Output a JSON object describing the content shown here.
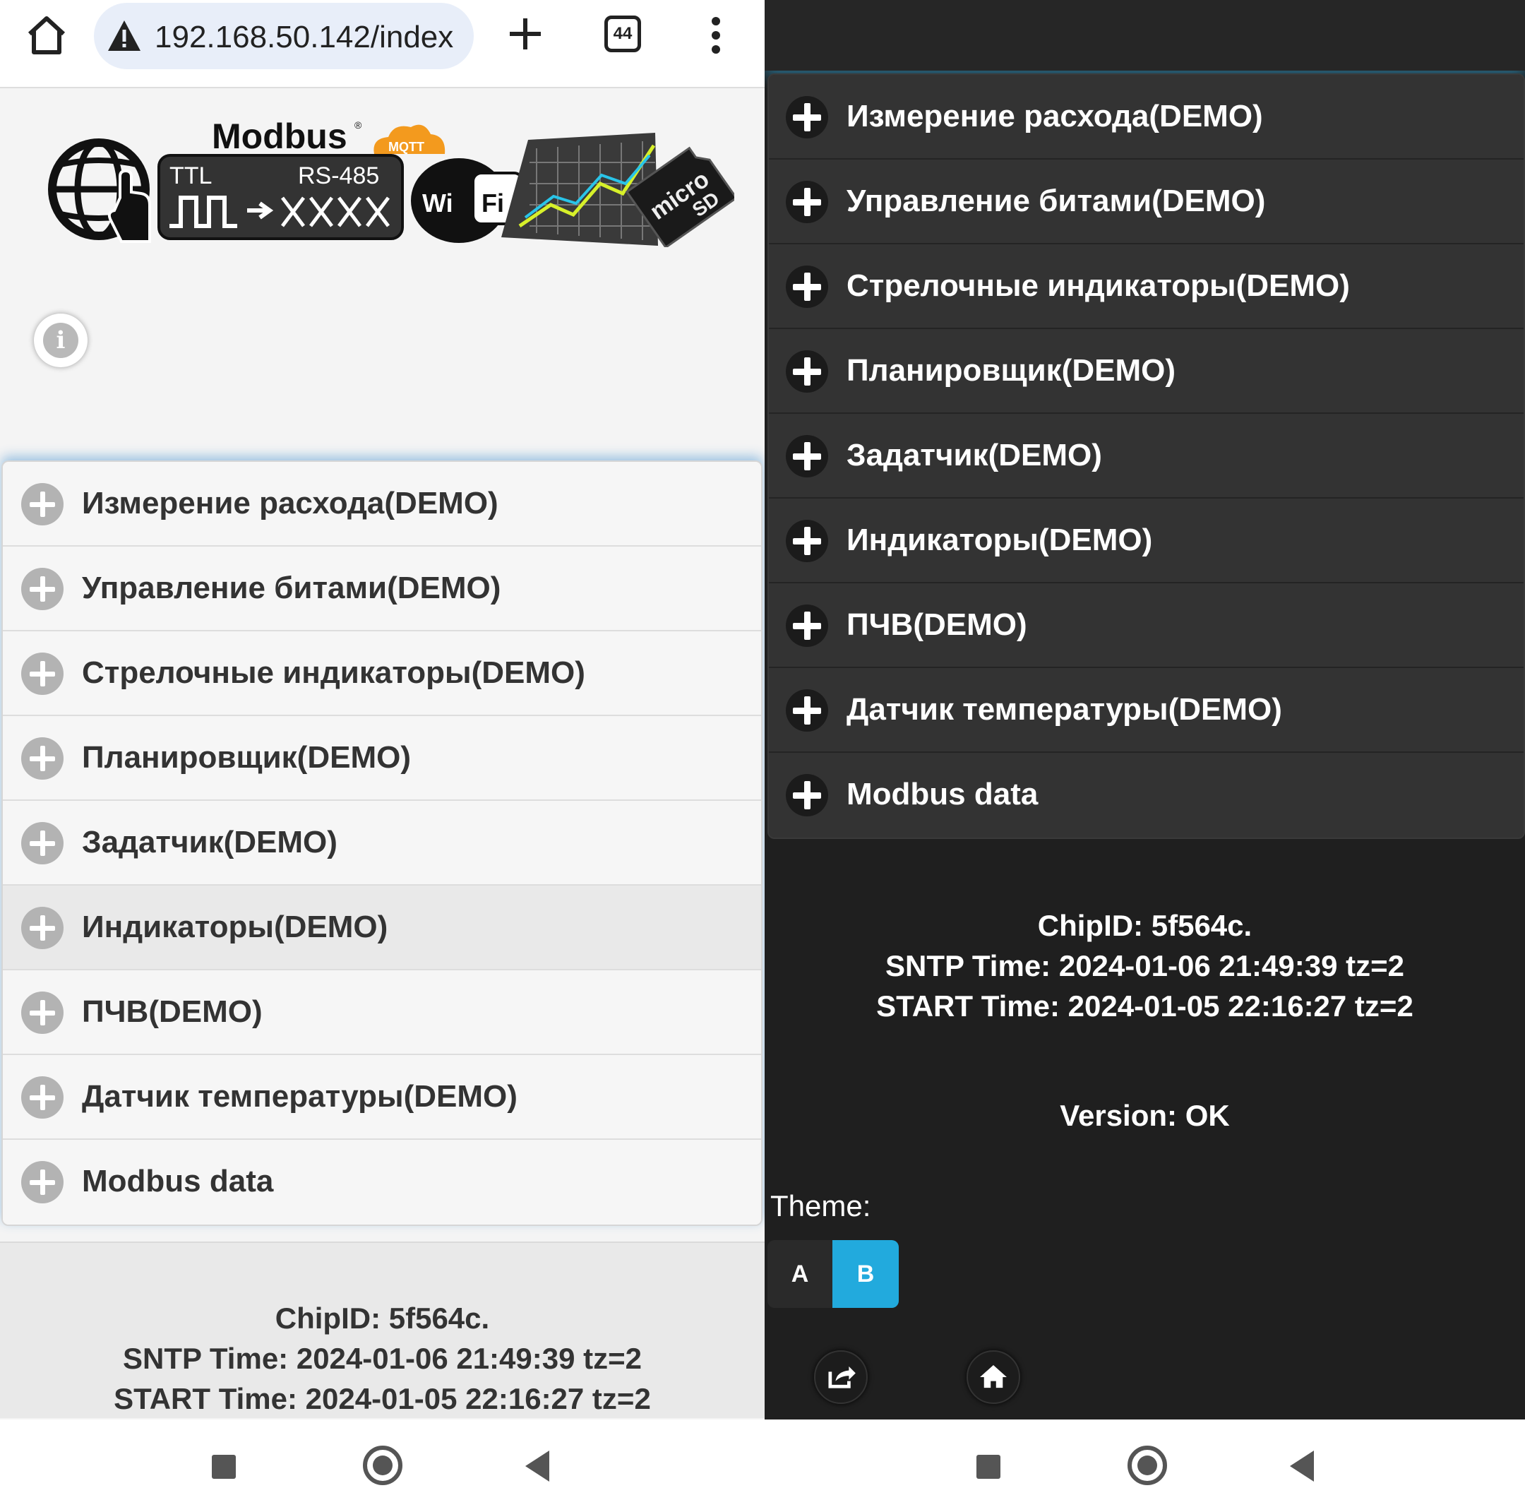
{
  "browser": {
    "url": "192.168.50.142/index",
    "tab_count": "44"
  },
  "logo": {
    "modbus": "Modbus",
    "registered": "®",
    "mqtt": "MQTT",
    "ttl": "TTL",
    "rs485": "RS-485",
    "wi": "Wi",
    "fi": "Fi",
    "micro": "micro",
    "sd": "SD"
  },
  "menu": {
    "items": [
      {
        "label": "Измерение расхода(DEMO)"
      },
      {
        "label": "Управление битами(DEMO)"
      },
      {
        "label": "Стрелочные индикаторы(DEMO)"
      },
      {
        "label": "Планировщик(DEMO)"
      },
      {
        "label": "Задатчик(DEMO)"
      },
      {
        "label": "Индикаторы(DEMO)"
      },
      {
        "label": "ПЧВ(DEMO)"
      },
      {
        "label": "Датчик температуры(DEMO)"
      },
      {
        "label": "Modbus data"
      }
    ]
  },
  "status": {
    "chip_id": "ChipID: 5f564c.",
    "sntp_time": "SNTP Time: 2024-01-06 21:49:39 tz=2",
    "start_time": "START Time: 2024-01-05 22:16:27 tz=2",
    "version": "Version: OK"
  },
  "theme": {
    "label": "Theme:",
    "option_a": "A",
    "option_b": "B",
    "selected": "B"
  },
  "colors": {
    "accent": "#22aadd",
    "light_bg": "#f6f6f6",
    "dark_bg": "#1f1f1f"
  },
  "icons": [
    "home-icon",
    "warning-icon",
    "plus-icon",
    "tabs-icon",
    "more-icon",
    "info-icon",
    "share-icon",
    "square-nav-icon",
    "circle-nav-icon",
    "back-nav-icon"
  ]
}
